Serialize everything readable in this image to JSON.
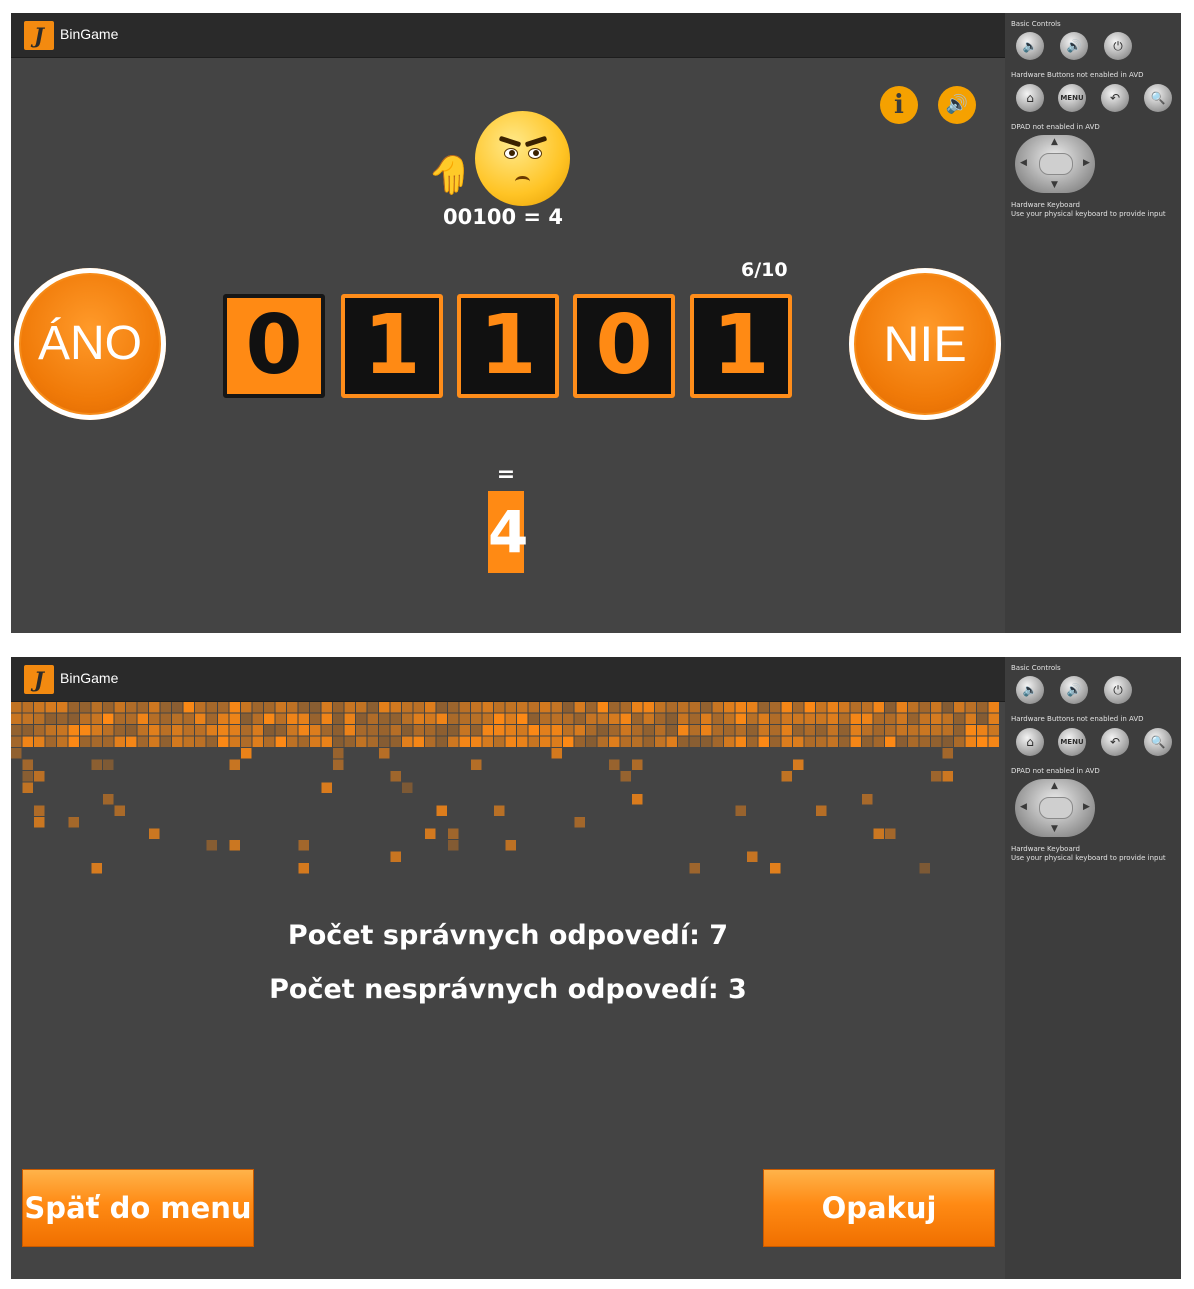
{
  "app": {
    "title": "BinGame"
  },
  "emulator": {
    "basic_controls": "Basic Controls",
    "hardware_buttons": "Hardware Buttons not enabled in AVD",
    "dpad": "DPAD not enabled in AVD",
    "keyboard_title": "Hardware Keyboard",
    "keyboard_hint": "Use your physical keyboard to provide input",
    "menu_label": "MENU"
  },
  "game": {
    "feedback": "00100 = 4",
    "progress": "6/10",
    "yes_label": "ÁNO",
    "no_label": "NIE",
    "bits": [
      {
        "value": "0",
        "state": "on"
      },
      {
        "value": "1",
        "state": "off"
      },
      {
        "value": "1",
        "state": "off"
      },
      {
        "value": "0",
        "state": "off"
      },
      {
        "value": "1",
        "state": "off"
      }
    ],
    "equals": "=",
    "result": "4",
    "accent_color": "#ff8a14"
  },
  "results": {
    "correct": "Počet správnych odpovedí: 7",
    "incorrect": "Počet nesprávnych odpovedí: 3",
    "back_label": "Späť do menu",
    "repeat_label": "Opakuj"
  }
}
